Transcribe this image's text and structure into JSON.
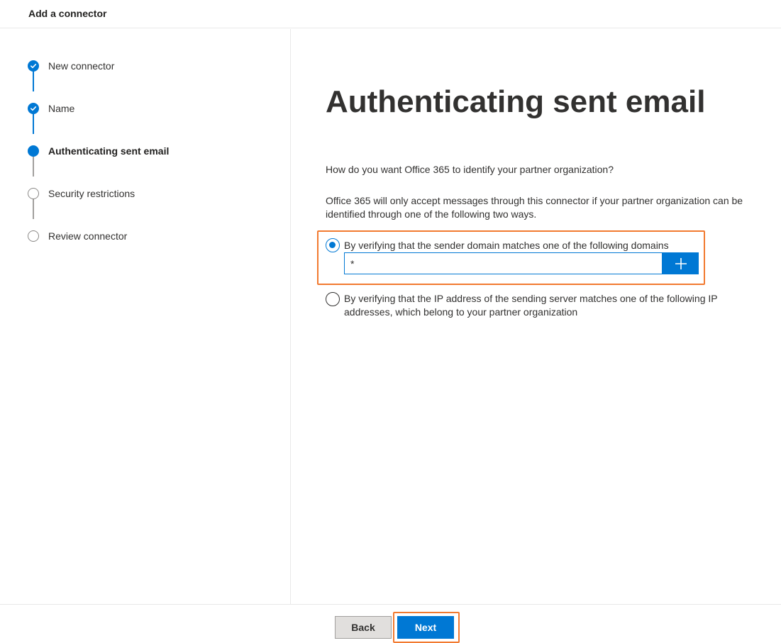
{
  "header": {
    "title": "Add a connector"
  },
  "steps": [
    {
      "label": "New connector",
      "state": "done"
    },
    {
      "label": "Name",
      "state": "done"
    },
    {
      "label": "Authenticating sent email",
      "state": "current"
    },
    {
      "label": "Security restrictions",
      "state": "todo"
    },
    {
      "label": "Review connector",
      "state": "todo"
    }
  ],
  "main": {
    "title": "Authenticating sent email",
    "question": "How do you want Office 365 to identify your partner organization?",
    "description": "Office 365 will only accept messages through this connector if your partner organization can be identified through one of the following two ways.",
    "options": [
      {
        "label": "By verifying that the sender domain matches one of the following domains",
        "selected": true
      },
      {
        "label": "By verifying that the IP address of the sending server matches one of the following IP addresses, which belong to your partner organization",
        "selected": false
      }
    ],
    "domain_input": {
      "value": "*"
    },
    "add_icon": "plus-icon"
  },
  "footer": {
    "back_label": "Back",
    "next_label": "Next"
  },
  "colors": {
    "accent": "#0078d4",
    "highlight": "#f27a30",
    "pending": "#8a8886",
    "text": "#323130"
  }
}
